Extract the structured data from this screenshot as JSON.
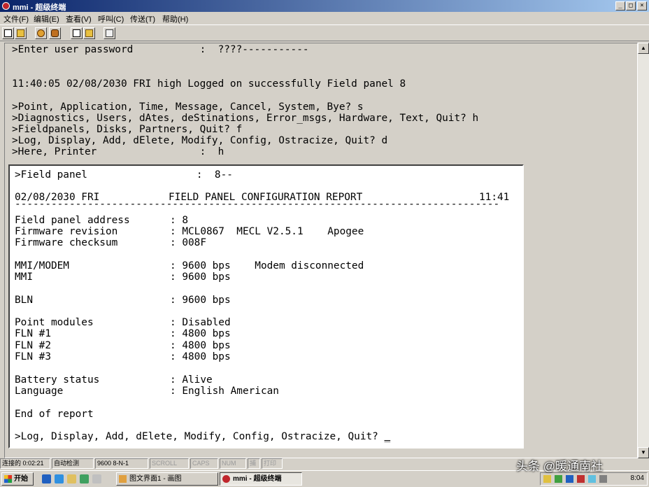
{
  "window": {
    "title": "mmi - 超级终端",
    "controls": {
      "minimize": "_",
      "maximize": "□",
      "close": "×"
    }
  },
  "menu": [
    "文件(F)",
    "编辑(E)",
    "查看(V)",
    "呼叫(C)",
    "传送(T)",
    "帮助(H)"
  ],
  "toolbar": [
    "new-icon",
    "open-icon",
    "connect-icon",
    "disconnect-icon",
    "send-icon",
    "receive-icon",
    "properties-icon"
  ],
  "terminal": {
    "lines": [
      ">Enter user password           :  ????-----------",
      "",
      "",
      "11:40:05 02/08/2030 FRI high Logged on successfully Field panel 8",
      "",
      ">Point, Application, Time, Message, Cancel, System, Bye? s",
      ">Diagnostics, Users, dAtes, deStinations, Error_msgs, Hardware, Text, Quit? h",
      ">Fieldpanels, Disks, Partners, Quit? f",
      ">Log, Display, Add, dElete, Modify, Config, Ostracize, Quit? d",
      ">Here, Printer                 :  h"
    ]
  },
  "report": {
    "prompt": ">Field panel                  :  8--",
    "header_date": "02/08/2030 FRI",
    "header_title": "FIELD PANEL CONFIGURATION REPORT",
    "header_time": "11:41",
    "separator": "--------------------------------------------------------------------------------",
    "rows": [
      {
        "label": "Field panel address",
        "value": ": 8"
      },
      {
        "label": "Firmware revision",
        "value": ": MCL0867  MECL V2.5.1    Apogee"
      },
      {
        "label": "Firmware checksum",
        "value": ": 008F"
      },
      {
        "label": "MMI/MODEM",
        "value": ": 9600 bps    Modem disconnected"
      },
      {
        "label": "MMI",
        "value": ": 9600 bps"
      },
      {
        "label": "BLN",
        "value": ": 9600 bps"
      },
      {
        "label": "Point modules",
        "value": ": Disabled"
      },
      {
        "label": "FLN #1",
        "value": ": 4800 bps"
      },
      {
        "label": "FLN #2",
        "value": ": 4800 bps"
      },
      {
        "label": "FLN #3",
        "value": ": 4800 bps"
      },
      {
        "label": "Battery status",
        "value": ": Alive"
      },
      {
        "label": "Language",
        "value": ": English American"
      }
    ],
    "end": "End of report",
    "final_prompt": ">Log, Display, Add, dElete, Modify, Config, Ostracize, Quit? ",
    "cursor": "_"
  },
  "statusbar": {
    "connected": "连接的 0:02:21",
    "detect": "自动检测",
    "baud": "9600 8-N-1",
    "scroll": "SCROLL",
    "caps": "CAPS",
    "num": "NUM",
    "capture": "捕",
    "echo": "打印"
  },
  "taskbar": {
    "start": "开始",
    "tasks": [
      "图文界面1 - 画图",
      "mmi - 超级终端"
    ],
    "clock": "8:04"
  },
  "watermark": "头条 @暖通南社"
}
